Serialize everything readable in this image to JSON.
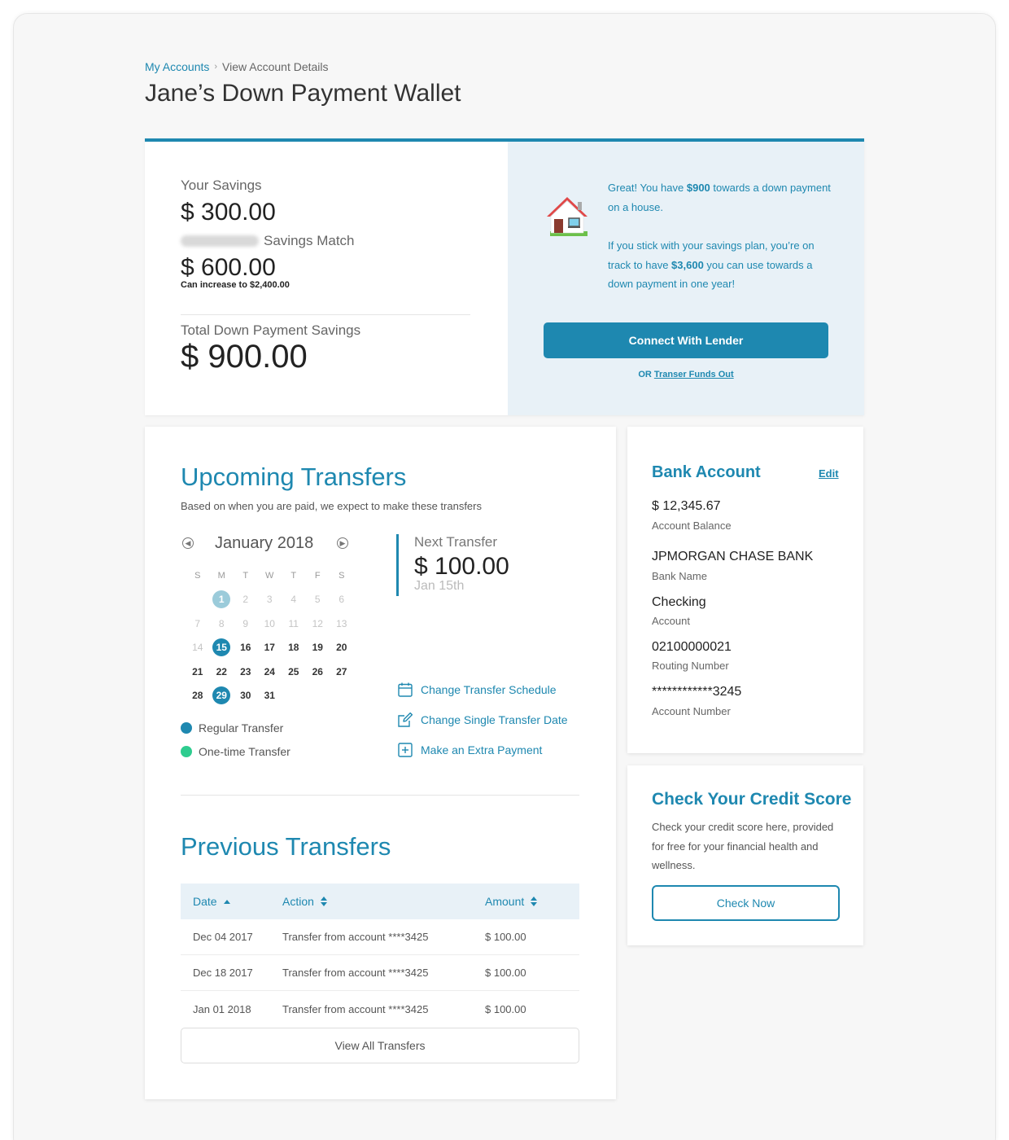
{
  "breadcrumb": {
    "link": "My Accounts",
    "current": "View Account Details"
  },
  "page_title": "Jane’s Down Payment Wallet",
  "summary": {
    "savings_label": "Your Savings",
    "savings_amount": "$ 300.00",
    "match_label": "Savings Match",
    "match_amount": "$ 600.00",
    "match_note": "Can increase to $2,400.00",
    "total_label": "Total Down Payment Savings",
    "total_amount": "$ 900.00",
    "msg1_pre": "Great! You have ",
    "msg1_bold": "$900",
    "msg1_post": " towards a down payment on a house.",
    "msg2_pre": "If you stick with your savings plan, you’re on track to have ",
    "msg2_bold": "$3,600",
    "msg2_post": " you can use towards a down payment in one year!",
    "lender_button": "Connect With Lender",
    "or_text": "OR",
    "transfer_out_link": "Transer Funds Out"
  },
  "upcoming": {
    "title": "Upcoming Transfers",
    "subtitle": "Based on when you are paid, we expect to make these transfers",
    "month": "January 2018",
    "dow": [
      "S",
      "M",
      "T",
      "W",
      "T",
      "F",
      "S"
    ],
    "weeks": [
      [
        {
          "d": ""
        },
        {
          "d": "1",
          "s": "light"
        },
        {
          "d": "2",
          "s": "faded"
        },
        {
          "d": "3",
          "s": "faded"
        },
        {
          "d": "4",
          "s": "faded"
        },
        {
          "d": "5",
          "s": "faded"
        },
        {
          "d": "6",
          "s": "faded"
        }
      ],
      [
        {
          "d": "7",
          "s": "faded"
        },
        {
          "d": "8",
          "s": "faded"
        },
        {
          "d": "9",
          "s": "faded"
        },
        {
          "d": "10",
          "s": "faded"
        },
        {
          "d": "11",
          "s": "faded"
        },
        {
          "d": "12",
          "s": "faded"
        },
        {
          "d": "13",
          "s": "faded"
        }
      ],
      [
        {
          "d": "14",
          "s": "faded"
        },
        {
          "d": "15",
          "s": "dark-dot"
        },
        {
          "d": "16",
          "s": "dark"
        },
        {
          "d": "17",
          "s": "dark"
        },
        {
          "d": "18",
          "s": "dark"
        },
        {
          "d": "19",
          "s": "dark"
        },
        {
          "d": "20",
          "s": "dark"
        }
      ],
      [
        {
          "d": "21",
          "s": "dark"
        },
        {
          "d": "22",
          "s": "dark"
        },
        {
          "d": "23",
          "s": "dark"
        },
        {
          "d": "24",
          "s": "dark"
        },
        {
          "d": "25",
          "s": "dark"
        },
        {
          "d": "26",
          "s": "dark"
        },
        {
          "d": "27",
          "s": "dark"
        }
      ],
      [
        {
          "d": "28",
          "s": "dark"
        },
        {
          "d": "29",
          "s": "dark-dot"
        },
        {
          "d": "30",
          "s": "dark"
        },
        {
          "d": "31",
          "s": "dark"
        },
        {
          "d": ""
        },
        {
          "d": ""
        },
        {
          "d": ""
        }
      ]
    ],
    "legend_regular": "Regular Transfer",
    "legend_onetime": "One-time Transfer",
    "legend_regular_color": "#1e88b0",
    "legend_onetime_color": "#2ecc8f",
    "next_label": "Next Transfer",
    "next_amount": "$ 100.00",
    "next_date": "Jan 15th",
    "actions": {
      "schedule": "Change Transfer Schedule",
      "single": "Change Single Transfer Date",
      "extra": "Make an Extra Payment"
    }
  },
  "previous": {
    "title": "Previous Transfers",
    "headers": {
      "date": "Date",
      "action": "Action",
      "amount": "Amount"
    },
    "rows": [
      {
        "date": "Dec 04 2017",
        "action": "Transfer from account ****3425",
        "amount": "$ 100.00"
      },
      {
        "date": "Dec 18 2017",
        "action": "Transfer from account ****3425",
        "amount": "$ 100.00"
      },
      {
        "date": "Jan 01 2018",
        "action": "Transfer from account ****3425",
        "amount": "$ 100.00"
      }
    ],
    "view_all": "View All Transfers"
  },
  "bank": {
    "title": "Bank Account",
    "edit": "Edit",
    "balance": "$ 12,345.67",
    "balance_label": "Account Balance",
    "bank_name": "JPMORGAN CHASE BANK",
    "bank_name_label": "Bank Name",
    "account_type": "Checking",
    "account_type_label": "Account",
    "routing": "02100000021",
    "routing_label": "Routing Number",
    "account_number": "************3245",
    "account_number_label": "Account Number"
  },
  "credit": {
    "title": "Check Your Credit Score",
    "description": "Check your credit score here, provided for free for your financial health and wellness.",
    "button": "Check Now"
  },
  "colors": {
    "accent": "#1e88b0",
    "panel": "#e8f1f7",
    "onetime": "#2ecc8f"
  }
}
